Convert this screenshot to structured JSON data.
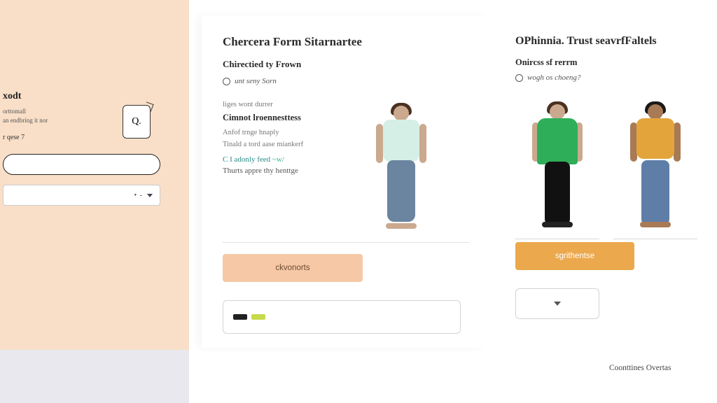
{
  "sidebar": {
    "title": "xodt",
    "line1": "orttomall",
    "line2": "an endbring it nor",
    "qty_label": "r qese 7",
    "promo_icon": "promo-card-icon"
  },
  "middle": {
    "title": "Chercera Form Sitarnartee",
    "subtitle": "Chirectied ty Frown",
    "radio_label": "unt seny Sorn",
    "lines": {
      "l1": "liges wont durrer",
      "strong": "Cimnot lroennesttess",
      "l2": "Anfof trnge hnaply",
      "l3": "Tinald a tord aase miankerf",
      "teal": "C I adonly feed",
      "teal_spark": "~w/",
      "l4": "Thurts appre thy henttge"
    },
    "cta": "ckvonorts",
    "product_alt": "model-mint-tee-blue-jeans"
  },
  "right": {
    "title": "OPhinnia. Trust seavrfFaltels",
    "subtitle": "Onircss sf rerrm",
    "radio_label": "wogh os choeng?",
    "cta": "sgrithentse",
    "footer": "Coonttines Overtas",
    "products": [
      {
        "alt": "model-green-top-black-pants"
      },
      {
        "alt": "model-orange-tee-denim-jeans"
      }
    ]
  }
}
